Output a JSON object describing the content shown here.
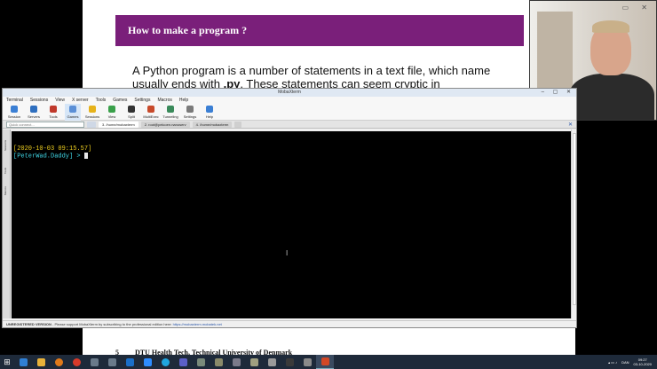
{
  "slide": {
    "header": "How to make a program ?",
    "body_prefix": "A Python program is a number of statements in a text file, which name usually ends with ",
    "body_ext": ".py",
    "body_suffix": ". These statements can seem cryptic in",
    "footer_page": "5",
    "footer_org": "DTU Health Tech, Technical University of Denmark"
  },
  "window": {
    "title": "MobaXterm",
    "menu": [
      "Terminal",
      "Sessions",
      "View",
      "X server",
      "Tools",
      "Games",
      "Settings",
      "Macros",
      "Help"
    ],
    "toolbar": [
      {
        "label": "Session",
        "icon": "session-icon",
        "color": "#3b7fd4"
      },
      {
        "label": "Servers",
        "icon": "servers-icon",
        "color": "#2f6fbf"
      },
      {
        "label": "Tools",
        "icon": "tools-icon",
        "color": "#c0392b"
      },
      {
        "label": "Games",
        "icon": "games-icon",
        "color": "#5a8fd6"
      },
      {
        "label": "Sessions",
        "icon": "star-icon",
        "color": "#e6b21a"
      },
      {
        "label": "View",
        "icon": "view-icon",
        "color": "#3aa04a"
      },
      {
        "label": "Split",
        "icon": "split-icon",
        "color": "#333333"
      },
      {
        "label": "MultiExec",
        "icon": "multiexec-icon",
        "color": "#c84a2a"
      },
      {
        "label": "Tunneling",
        "icon": "tunneling-icon",
        "color": "#3a8a5a"
      },
      {
        "label": "Settings",
        "icon": "settings-icon",
        "color": "#7a7a7a"
      },
      {
        "label": "Help",
        "icon": "help-icon",
        "color": "#3b7fd4"
      }
    ],
    "quick_connect_placeholder": "Quick connect...",
    "tabs": [
      "3. /home/mobaxterm",
      "2. root@pelcoen.nanoserv",
      "4. /home/mobaxterm"
    ],
    "sidebar": [
      "Sessions",
      "Tools",
      "Macros"
    ],
    "terminal": {
      "line1": "[2020-10-03 09:15.57]",
      "line2": "[PeterWad.Daddy] > "
    },
    "status": {
      "bold": "UNREGISTERED VERSION",
      "text": " - Please support MobaXterm by subscribing to the professional edition here: ",
      "link": "https://mobaxterm.mobatek.net"
    }
  },
  "taskbar": {
    "apps": [
      {
        "icon": "edge-icon",
        "color": "#2f7fd4"
      },
      {
        "icon": "file-explorer-icon",
        "color": "#e8b23a"
      },
      {
        "icon": "firefox-icon",
        "color": "#e07a1a"
      },
      {
        "icon": "chrome-icon",
        "color": "#d83a2a"
      },
      {
        "icon": "app-icon",
        "color": "#6a7a8a"
      },
      {
        "icon": "app-icon",
        "color": "#6a7a8a"
      },
      {
        "icon": "outlook-icon",
        "color": "#1a6fc9"
      },
      {
        "icon": "zoom-icon",
        "color": "#2d8cff"
      },
      {
        "icon": "skype-icon",
        "color": "#1fa6e0"
      },
      {
        "icon": "teams-icon",
        "color": "#5b5fc7"
      },
      {
        "icon": "app-icon",
        "color": "#7a8a7a"
      },
      {
        "icon": "app-icon",
        "color": "#8a8a6a"
      },
      {
        "icon": "app-icon",
        "color": "#7a7a8a"
      },
      {
        "icon": "app-icon",
        "color": "#a0a080"
      },
      {
        "icon": "app-icon",
        "color": "#9a9a9a"
      },
      {
        "icon": "app-icon",
        "color": "#3a3a3a"
      },
      {
        "icon": "app-icon",
        "color": "#8a8a8a"
      },
      {
        "icon": "powerpoint-icon",
        "color": "#d24726"
      }
    ],
    "lang": "DAN",
    "time": "09:27",
    "date": "03-10-2020"
  }
}
